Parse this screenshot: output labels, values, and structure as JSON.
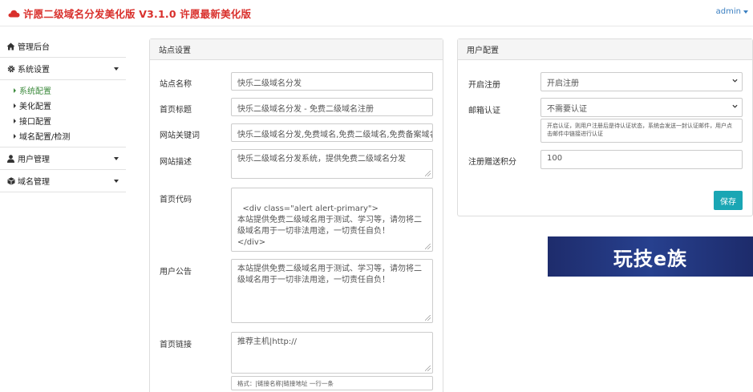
{
  "header": {
    "brand_title": "许愿二级域名分发美化版 V3.1.0 许愿最新美化版",
    "user": "admin"
  },
  "sidebar": {
    "items": [
      {
        "label": "管理后台",
        "icon": "home-icon"
      },
      {
        "label": "系统设置",
        "icon": "gear-icon"
      },
      {
        "label": "用户管理",
        "icon": "user-icon"
      },
      {
        "label": "域名管理",
        "icon": "cube-icon"
      }
    ],
    "sub_items": [
      {
        "label": "系统配置",
        "active": true
      },
      {
        "label": "美化配置",
        "active": false
      },
      {
        "label": "接口配置",
        "active": false
      },
      {
        "label": "域名配置/检测",
        "active": false
      }
    ]
  },
  "site_settings": {
    "title": "站点设置",
    "fields": [
      {
        "label": "站点名称",
        "value": "快乐二级域名分发"
      },
      {
        "label": "首页标题",
        "value": "快乐二级域名分发 - 免费二级域名注册"
      },
      {
        "label": "网站关键词",
        "value": "快乐二级域名分发,免费域名,免费二级域名,免费备案域名"
      },
      {
        "label": "网站描述",
        "value": "快乐二级域名分发系统，提供免费二级域名分发"
      },
      {
        "label": "首页代码",
        "value": "<div class=\"alert alert-primary\">\n本站提供免费二级域名用于测试、学习等，请勿将二级域名用于一切非法用途，一切责任自负！\n</div>"
      },
      {
        "label": "用户公告",
        "value": "本站提供免费二级域名用于测试、学习等，请勿将二级域名用于一切非法用途，一切责任自负！"
      },
      {
        "label": "首页链接",
        "value": "推荐主机|http://"
      }
    ],
    "link_hint": "格式：|链接名称|链接地址 一行一条"
  },
  "user_config": {
    "title": "用户配置",
    "register_label": "开启注册",
    "register_value": "开启注册",
    "email_label": "邮箱认证",
    "email_value": "不需要认证",
    "email_help": "开启认证，则用户注册后是待认证状态，系统会发送一封认证邮件，用户点击邮件中链接进行认证",
    "points_label": "注册赠送积分",
    "points_value": "100",
    "save_label": "保存"
  },
  "banner": {
    "text": "玩技e族"
  },
  "colors": {
    "brand": "#d9302c",
    "accent": "#1aa6b4",
    "active_nav": "#3c8a3c",
    "link": "#3a7fc1"
  }
}
